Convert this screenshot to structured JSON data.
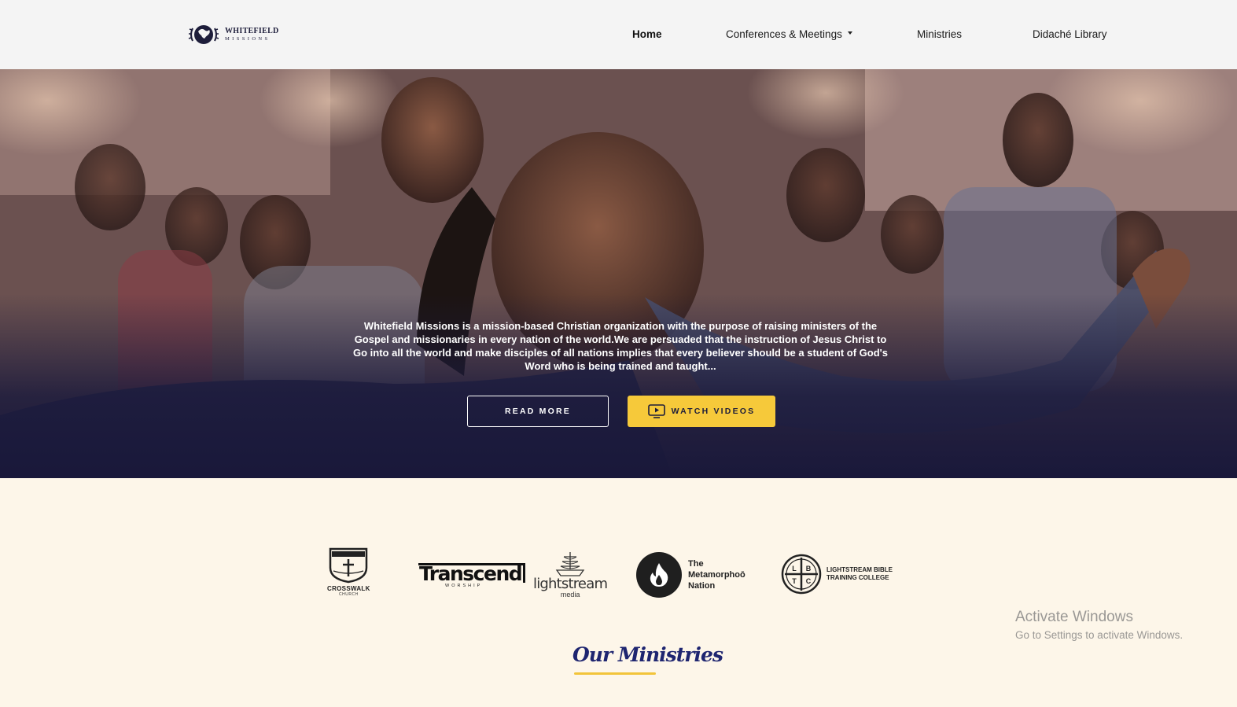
{
  "header": {
    "logo": {
      "line1": "WHITEFIELD",
      "line2": "MISSIONS"
    },
    "nav": [
      {
        "label": "Home"
      },
      {
        "label": "Conferences & Meetings"
      },
      {
        "label": "Ministries"
      },
      {
        "label": "Didaché Library"
      }
    ]
  },
  "hero": {
    "description": "Whitefield Missions is a mission-based Christian organization with the purpose of raising ministers of the Gospel and missionaries in every nation of the world.We are persuaded that the instruction of Jesus Christ to Go into all the world and make disciples of all nations implies that every believer should be a student of God's Word who is being trained and taught...",
    "read_more_label": "READ MORE",
    "watch_videos_label": "WATCH VIDEOS",
    "watch_icon": "video-play-icon"
  },
  "partners": {
    "crosswalk": {
      "name": "CROSSWALK",
      "sub": "CHURCH",
      "badge": "CROSSWALK"
    },
    "transcend": {
      "name": "Transcend",
      "sub": "WORSHIP"
    },
    "lightstream": {
      "name": "lightstream",
      "sub": "media"
    },
    "metamorphoo": {
      "lines": [
        "The",
        "Metamorphoō",
        "Nation"
      ],
      "icon": "flame-icon"
    },
    "lbtc": {
      "lines": [
        "LIGHTSTREAM BIBLE",
        "TRAINING COLLEGE"
      ],
      "letters": [
        "L",
        "B",
        "T",
        "C"
      ]
    }
  },
  "watermark": {
    "title": "Activate Windows",
    "subtitle": "Go to Settings to activate Windows."
  },
  "ministries": {
    "heading": "Our Ministries"
  },
  "colors": {
    "header_bg": "#f4f4f4",
    "hero_overlay": "#1b1a3c",
    "accent_yellow": "#f6c93a",
    "page_bg": "#fdf6e9",
    "heading_blue": "#1e2570"
  }
}
